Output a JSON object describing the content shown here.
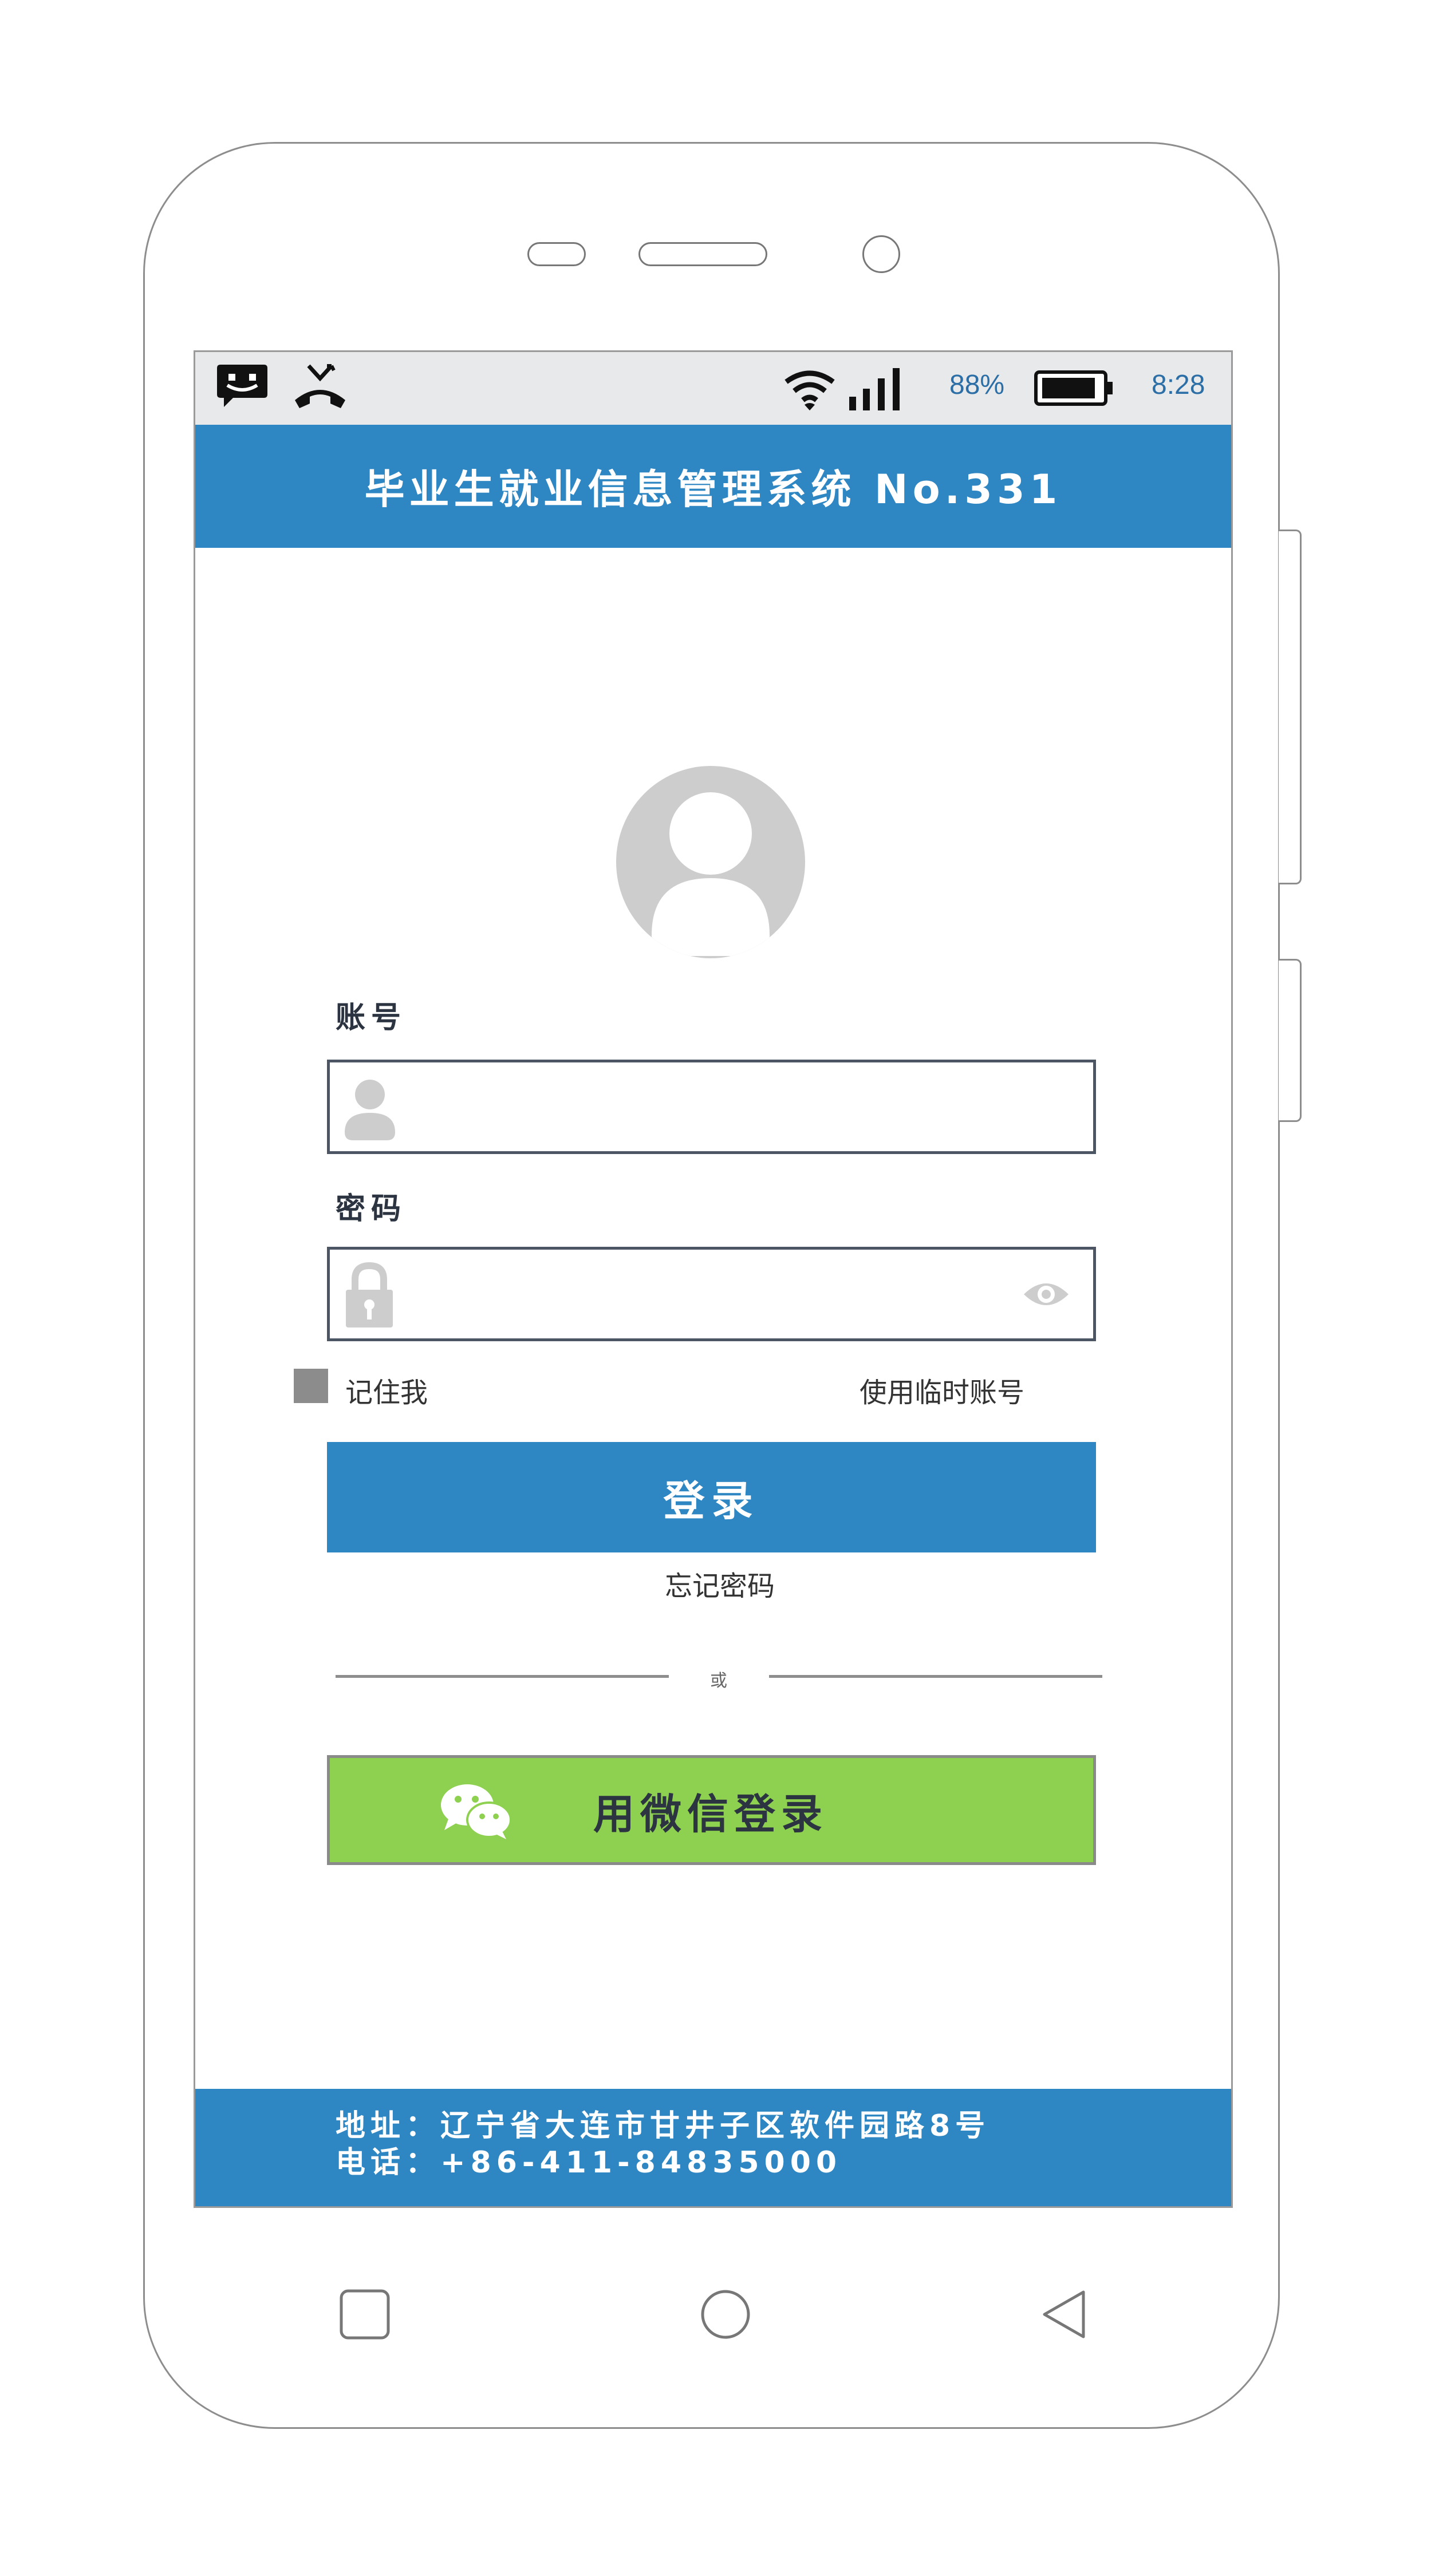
{
  "status_bar": {
    "icons": [
      "message-icon",
      "missed-call-icon",
      "wifi-icon",
      "signal-icon",
      "battery-icon"
    ],
    "battery_percent": "88%",
    "time": "8:28"
  },
  "app_bar": {
    "title": "毕业生就业信息管理系统 No.331"
  },
  "login_form": {
    "avatar_icon": "user-avatar-icon",
    "account_label": "账号",
    "account_value": "",
    "password_label": "密码",
    "password_value": "",
    "remember_me_label": "记住我",
    "temp_account_link": "使用临时账号",
    "login_button": "登录",
    "forgot_password_link": "忘记密码",
    "divider_text": "或",
    "wechat_login_button": "用微信登录"
  },
  "footer": {
    "address": "地址：辽宁省大连市甘井子区软件园路8号",
    "phone": "电话：+86-411-84835000"
  },
  "nav_bar": {
    "keys": [
      "recent-apps-icon",
      "home-icon",
      "back-icon"
    ]
  },
  "colors": {
    "primary_blue": "#2e86c3",
    "wechat_green": "#8ed04f",
    "status_bar_bg": "#e8e9ea",
    "placeholder_icon_gray": "#cdcdcd"
  }
}
